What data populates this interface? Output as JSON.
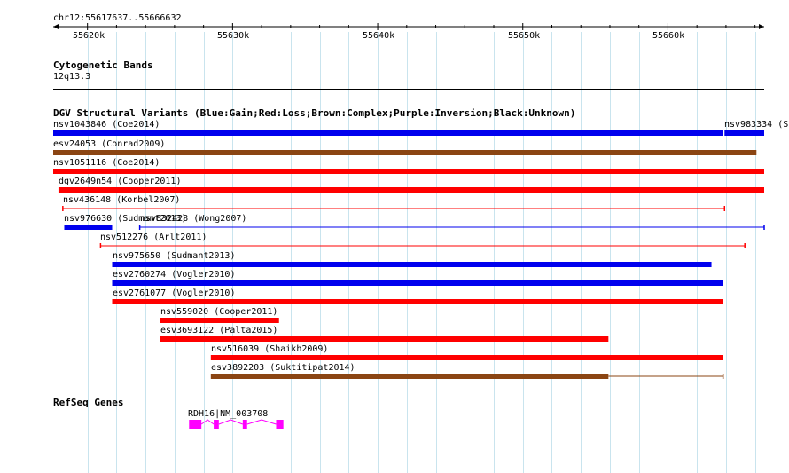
{
  "ruler": {
    "location": "chr12:55617637..55666632",
    "start": 55617637,
    "end": 55666632,
    "ticks": [
      55620000,
      55630000,
      55640000,
      55650000,
      55660000
    ],
    "tick_labels": [
      "55620k",
      "55630k",
      "55640k",
      "55650k",
      "55660k"
    ]
  },
  "tracks": {
    "cytoband": {
      "title": "Cytogenetic Bands",
      "band": "12q13.3"
    },
    "dgv": {
      "title": "DGV Structural Variants (Blue:Gain;Red:Loss;Brown:Complex;Purple:Inversion;Black:Unknown)",
      "colors": {
        "gain": "#0000ee",
        "loss": "#ff0000",
        "complex": "#8b4513"
      },
      "features": [
        {
          "label": "nsv1043846 (Coe2014)",
          "type": "gain",
          "style": "bar",
          "start": 55617637,
          "end": 55663800
        },
        {
          "label": "nsv983334 (S",
          "type": "gain",
          "style": "bar",
          "start": 55663900,
          "end": 55666632
        },
        {
          "label": "esv24053 (Conrad2009)",
          "type": "complex",
          "style": "bar",
          "start": 55617637,
          "end": 55666100
        },
        {
          "label": "nsv1051116 (Coe2014)",
          "type": "loss",
          "style": "bar",
          "start": 55617637,
          "end": 55666632
        },
        {
          "label": "dgv2649n54 (Cooper2011)",
          "type": "loss",
          "style": "bar",
          "start": 55618000,
          "end": 55666632
        },
        {
          "label": "nsv436148 (Korbel2007)",
          "type": "loss",
          "style": "line",
          "start": 55618300,
          "end": 55663900
        },
        {
          "label": "nsv976630 (Sudmant2013)",
          "type": "gain",
          "style": "bar",
          "start": 55618400,
          "end": 55621700
        },
        {
          "label": "nsv832428 (Wong2007)",
          "type": "gain",
          "style": "line",
          "start": 55623600,
          "end": 55666632
        },
        {
          "label": "nsv512276 (Arlt2011)",
          "type": "loss",
          "style": "line",
          "start": 55620900,
          "end": 55665300
        },
        {
          "label": "nsv975650 (Sudmant2013)",
          "type": "gain",
          "style": "bar",
          "start": 55621700,
          "end": 55663000
        },
        {
          "label": "esv2760274 (Vogler2010)",
          "type": "gain",
          "style": "bar",
          "start": 55621700,
          "end": 55663800
        },
        {
          "label": "esv2761077 (Vogler2010)",
          "type": "loss",
          "style": "bar",
          "start": 55621700,
          "end": 55663800
        },
        {
          "label": "nsv559020 (Cooper2011)",
          "type": "loss",
          "style": "bar",
          "start": 55625000,
          "end": 55633200
        },
        {
          "label": "esv3693122 (Palta2015)",
          "type": "loss",
          "style": "bar",
          "start": 55625000,
          "end": 55655900
        },
        {
          "label": "nsv516039 (Shaikh2009)",
          "type": "loss",
          "style": "bar",
          "start": 55628500,
          "end": 55663800
        },
        {
          "label": "esv3892203 (Suktitipat2014)",
          "type": "complex",
          "style": "bar_tail",
          "start": 55628500,
          "end": 55663800,
          "thick_end": 55655900
        }
      ]
    },
    "refseq": {
      "title": "RefSeq Genes",
      "color": "#ff00ff",
      "gene": {
        "label": "RDH16|NM_003708",
        "start": 55627000,
        "end": 55633500,
        "exons": [
          [
            55627000,
            55627850
          ],
          [
            55628700,
            55629050
          ],
          [
            55630700,
            55631000
          ],
          [
            55633000,
            55633500
          ]
        ]
      }
    }
  }
}
